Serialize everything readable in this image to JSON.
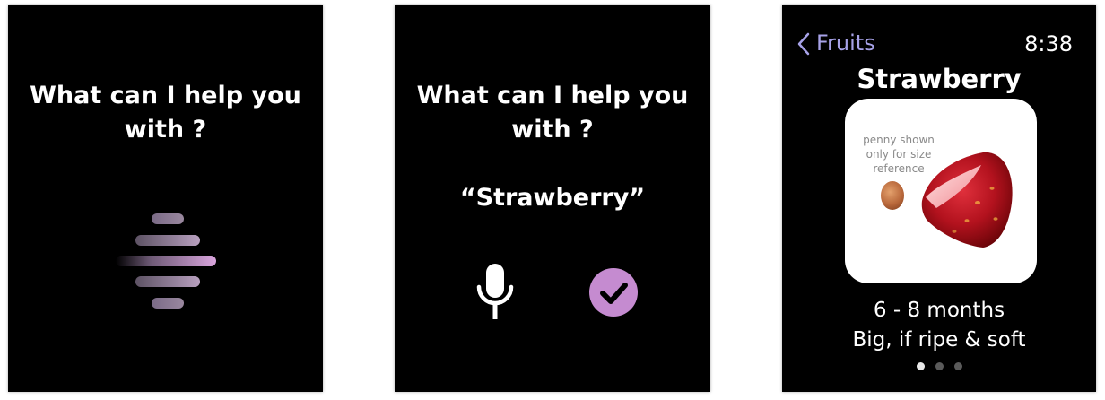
{
  "screen_listening": {
    "prompt": "What can I help you with ?"
  },
  "screen_confirm": {
    "prompt": "What can I help you with ?",
    "transcript": "“Strawberry”",
    "icons": {
      "mic": "microphone-icon",
      "confirm": "checkmark-icon"
    },
    "accent_color": "#c58bd0"
  },
  "screen_detail": {
    "back_label": "Fruits",
    "time": "8:38",
    "title": "Strawberry",
    "image_caption": "penny shown only for size reference",
    "age": "6 - 8 months",
    "ripeness": "Big, if ripe & soft",
    "pages": {
      "count": 3,
      "current": 1
    },
    "back_color": "#a7a2e8"
  }
}
